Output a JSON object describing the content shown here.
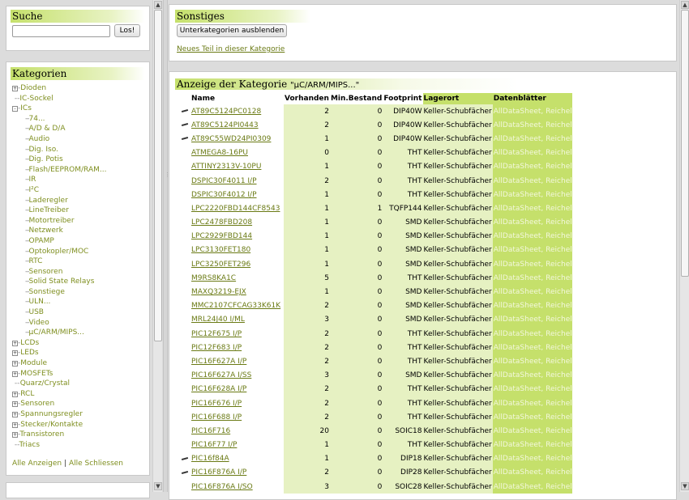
{
  "search": {
    "title": "Suche",
    "value": "",
    "button_label": "Los!"
  },
  "categories": {
    "title": "Kategorien",
    "tree": [
      {
        "label": "Dioden",
        "expander": "+",
        "level": 0
      },
      {
        "label": "IC-Sockel",
        "expander": "",
        "level": 0
      },
      {
        "label": "ICs",
        "expander": "-",
        "level": 0
      },
      {
        "label": "74...",
        "expander": "",
        "level": 1
      },
      {
        "label": "A/D & D/A",
        "expander": "",
        "level": 1
      },
      {
        "label": "Audio",
        "expander": "",
        "level": 1
      },
      {
        "label": "Dig. Iso.",
        "expander": "",
        "level": 1
      },
      {
        "label": "Dig. Potis",
        "expander": "",
        "level": 1
      },
      {
        "label": "Flash/EEPROM/RAM...",
        "expander": "",
        "level": 1
      },
      {
        "label": "IR",
        "expander": "",
        "level": 1
      },
      {
        "label": "I²C",
        "expander": "",
        "level": 1
      },
      {
        "label": "Laderegler",
        "expander": "",
        "level": 1
      },
      {
        "label": "LineTreiber",
        "expander": "",
        "level": 1
      },
      {
        "label": "Motortreiber",
        "expander": "",
        "level": 1
      },
      {
        "label": "Netzwerk",
        "expander": "",
        "level": 1
      },
      {
        "label": "OPAMP",
        "expander": "",
        "level": 1
      },
      {
        "label": "Optokopler/MOC",
        "expander": "",
        "level": 1
      },
      {
        "label": "RTC",
        "expander": "",
        "level": 1
      },
      {
        "label": "Sensoren",
        "expander": "",
        "level": 1
      },
      {
        "label": "Solid State Relays",
        "expander": "",
        "level": 1
      },
      {
        "label": "Sonstiege",
        "expander": "",
        "level": 1
      },
      {
        "label": "ULN...",
        "expander": "",
        "level": 1
      },
      {
        "label": "USB",
        "expander": "",
        "level": 1
      },
      {
        "label": "Video",
        "expander": "",
        "level": 1
      },
      {
        "label": "µC/ARM/MIPS...",
        "expander": "",
        "level": 1
      },
      {
        "label": "LCDs",
        "expander": "+",
        "level": 0
      },
      {
        "label": "LEDs",
        "expander": "+",
        "level": 0
      },
      {
        "label": "Module",
        "expander": "+",
        "level": 0
      },
      {
        "label": "MOSFETs",
        "expander": "+",
        "level": 0
      },
      {
        "label": "Quarz/Crystal",
        "expander": "",
        "level": 0
      },
      {
        "label": "RCL",
        "expander": "+",
        "level": 0
      },
      {
        "label": "Sensoren",
        "expander": "+",
        "level": 0
      },
      {
        "label": "Spannungsregler",
        "expander": "+",
        "level": 0
      },
      {
        "label": "Stecker/Kontakte",
        "expander": "+",
        "level": 0
      },
      {
        "label": "Transistoren",
        "expander": "+",
        "level": 0
      },
      {
        "label": "Triacs",
        "expander": "",
        "level": 0
      }
    ],
    "show_all": "Alle Anzeigen",
    "separator": "|",
    "close_all": "Alle Schliessen"
  },
  "misc": {
    "title": "Sonstiges",
    "hide_subcats_label": "Unterkategorien ausblenden",
    "new_part_link": "Neues Teil in dieser Kategorie"
  },
  "category_view": {
    "title_prefix": "Anzeige der Kategorie ",
    "title_category": "\"µC/ARM/MIPS...\"",
    "columns": [
      "Name",
      "Vorhanden",
      "Min.Bestand",
      "Footprint",
      "Lagerort",
      "Datenblätter"
    ],
    "datasheet_text": "AllDataSheet, Reichelt",
    "rows": [
      {
        "mark": true,
        "name": "AT89C5124PC0128",
        "vorhanden": "2",
        "min": "0",
        "footprint": "DIP40W",
        "lagerort": "Keller-Schubfächer"
      },
      {
        "mark": true,
        "name": "AT89C5124PI0443",
        "vorhanden": "2",
        "min": "0",
        "footprint": "DIP40W",
        "lagerort": "Keller-Schubfächer"
      },
      {
        "mark": true,
        "name": "AT89C55WD24PI0309",
        "vorhanden": "1",
        "min": "0",
        "footprint": "DIP40W",
        "lagerort": "Keller-Schubfächer"
      },
      {
        "mark": false,
        "name": "ATMEGA8-16PU",
        "vorhanden": "0",
        "min": "0",
        "footprint": "THT",
        "lagerort": "Keller-Schubfächer"
      },
      {
        "mark": false,
        "name": "ATTINY2313V-10PU",
        "vorhanden": "1",
        "min": "0",
        "footprint": "THT",
        "lagerort": "Keller-Schubfächer"
      },
      {
        "mark": false,
        "name": "DSPIC30F4011 I/P",
        "vorhanden": "2",
        "min": "0",
        "footprint": "THT",
        "lagerort": "Keller-Schubfächer"
      },
      {
        "mark": false,
        "name": "DSPIC30F4012 I/P",
        "vorhanden": "1",
        "min": "0",
        "footprint": "THT",
        "lagerort": "Keller-Schubfächer"
      },
      {
        "mark": false,
        "name": "LPC2220FBD144CF8543",
        "vorhanden": "1",
        "min": "1",
        "footprint": "TQFP144",
        "lagerort": "Keller-Schubfächer"
      },
      {
        "mark": false,
        "name": "LPC2478FBD208",
        "vorhanden": "1",
        "min": "0",
        "footprint": "SMD",
        "lagerort": "Keller-Schubfächer"
      },
      {
        "mark": false,
        "name": "LPC2929FBD144",
        "vorhanden": "1",
        "min": "0",
        "footprint": "SMD",
        "lagerort": "Keller-Schubfächer"
      },
      {
        "mark": false,
        "name": "LPC3130FET180",
        "vorhanden": "1",
        "min": "0",
        "footprint": "SMD",
        "lagerort": "Keller-Schubfächer"
      },
      {
        "mark": false,
        "name": "LPC3250FET296",
        "vorhanden": "1",
        "min": "0",
        "footprint": "SMD",
        "lagerort": "Keller-Schubfächer"
      },
      {
        "mark": false,
        "name": "M9RS8KA1C",
        "vorhanden": "5",
        "min": "0",
        "footprint": "THT",
        "lagerort": "Keller-Schubfächer"
      },
      {
        "mark": false,
        "name": "MAXQ3219-EJX",
        "vorhanden": "1",
        "min": "0",
        "footprint": "SMD",
        "lagerort": "Keller-Schubfächer"
      },
      {
        "mark": false,
        "name": "MMC2107CFCAG33K61K",
        "vorhanden": "2",
        "min": "0",
        "footprint": "SMD",
        "lagerort": "Keller-Schubfächer"
      },
      {
        "mark": false,
        "name": "MRL24J40 I/ML",
        "vorhanden": "3",
        "min": "0",
        "footprint": "SMD",
        "lagerort": "Keller-Schubfächer"
      },
      {
        "mark": false,
        "name": "PIC12F675 I/P",
        "vorhanden": "2",
        "min": "0",
        "footprint": "THT",
        "lagerort": "Keller-Schubfächer"
      },
      {
        "mark": false,
        "name": "PIC12F683 I/P",
        "vorhanden": "2",
        "min": "0",
        "footprint": "THT",
        "lagerort": "Keller-Schubfächer"
      },
      {
        "mark": false,
        "name": "PIC16F627A I/P",
        "vorhanden": "2",
        "min": "0",
        "footprint": "THT",
        "lagerort": "Keller-Schubfächer"
      },
      {
        "mark": false,
        "name": "PIC16F627A I/SS",
        "vorhanden": "3",
        "min": "0",
        "footprint": "SMD",
        "lagerort": "Keller-Schubfächer"
      },
      {
        "mark": false,
        "name": "PIC16F628A I/P",
        "vorhanden": "2",
        "min": "0",
        "footprint": "THT",
        "lagerort": "Keller-Schubfächer"
      },
      {
        "mark": false,
        "name": "PIC16F676 I/P",
        "vorhanden": "2",
        "min": "0",
        "footprint": "THT",
        "lagerort": "Keller-Schubfächer"
      },
      {
        "mark": false,
        "name": "PIC16F688 I/P",
        "vorhanden": "2",
        "min": "0",
        "footprint": "THT",
        "lagerort": "Keller-Schubfächer"
      },
      {
        "mark": false,
        "name": "PIC16F716",
        "vorhanden": "20",
        "min": "0",
        "footprint": "SOIC18",
        "lagerort": "Keller-Schubfächer"
      },
      {
        "mark": false,
        "name": "PIC16F77 I/P",
        "vorhanden": "1",
        "min": "0",
        "footprint": "THT",
        "lagerort": "Keller-Schubfächer"
      },
      {
        "mark": true,
        "name": "PIC16f84A",
        "vorhanden": "1",
        "min": "0",
        "footprint": "DIP18",
        "lagerort": "Keller-Schubfächer"
      },
      {
        "mark": true,
        "name": "PIC16F876A I/P",
        "vorhanden": "2",
        "min": "0",
        "footprint": "DIP28",
        "lagerort": "Keller-Schubfächer"
      },
      {
        "mark": false,
        "name": "PIC16F876A I/SO",
        "vorhanden": "3",
        "min": "0",
        "footprint": "SOIC28",
        "lagerort": "Keller-Schubfächer"
      }
    ]
  },
  "colors": {
    "accent_green": "#c5e06b",
    "light_green": "#e6f1c2",
    "link_olive": "#7f8f20"
  }
}
